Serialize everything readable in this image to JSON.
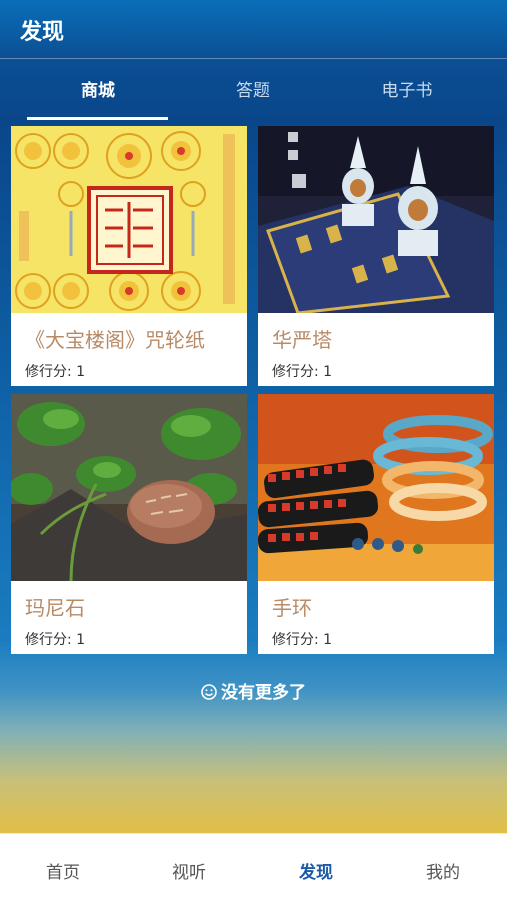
{
  "header": {
    "title": "发现"
  },
  "tabs": [
    {
      "label": "商城",
      "active": true
    },
    {
      "label": "答题",
      "active": false
    },
    {
      "label": "电子书",
      "active": false
    }
  ],
  "products": [
    {
      "name": "《大宝楼阁》咒轮纸",
      "score": "修行分: 1",
      "image": "mantra-wheel-paper"
    },
    {
      "name": "华严塔",
      "score": "修行分: 1",
      "image": "crystal-stupa"
    },
    {
      "name": "玛尼石",
      "score": "修行分: 1",
      "image": "mani-stone"
    },
    {
      "name": "手环",
      "score": "修行分: 1",
      "image": "bracelets"
    }
  ],
  "footer_note": "没有更多了",
  "bottom_nav": [
    {
      "label": "首页",
      "active": false
    },
    {
      "label": "视听",
      "active": false
    },
    {
      "label": "发现",
      "active": true
    },
    {
      "label": "我的",
      "active": false
    }
  ],
  "colors": {
    "accent": "#1a5aa8",
    "product_name": "#b88b67"
  }
}
